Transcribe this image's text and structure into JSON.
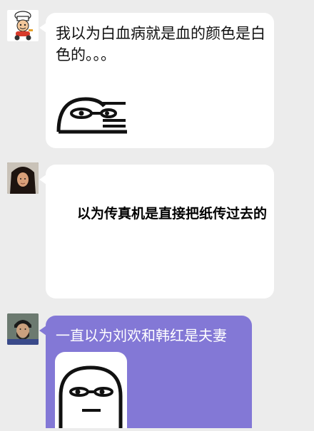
{
  "messages": [
    {
      "text": "我以为白血病就是血的颜色是白色的。。。",
      "avatar_icon": "chef-cartoon-avatar",
      "sticker_icon": "sideeye-face-sticker"
    },
    {
      "text": "以为传真机是直接把纸传过去的",
      "avatar_icon": "long-hair-person-avatar"
    },
    {
      "text": "一直以为刘欢和韩红是夫妻",
      "avatar_icon": "bearded-person-avatar",
      "sticker_icon": "blank-stare-face-sticker"
    }
  ],
  "colors": {
    "background": "#ececec",
    "bubble_white": "#ffffff",
    "bubble_purple": "#8378d6",
    "text_dark": "#111111",
    "text_light": "#ffffff"
  }
}
